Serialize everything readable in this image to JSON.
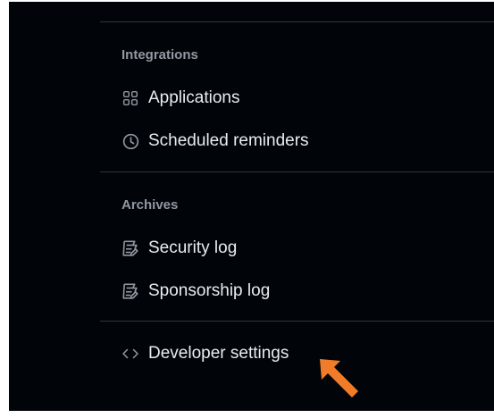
{
  "sidebar": {
    "integrations": {
      "title": "Integrations",
      "items": [
        {
          "label": "Applications",
          "icon": "apps-grid-icon"
        },
        {
          "label": "Scheduled reminders",
          "icon": "clock-icon"
        }
      ]
    },
    "archives": {
      "title": "Archives",
      "items": [
        {
          "label": "Security log",
          "icon": "log-icon"
        },
        {
          "label": "Sponsorship log",
          "icon": "log-icon"
        }
      ]
    },
    "developer": {
      "label": "Developer settings",
      "icon": "code-icon"
    }
  },
  "annotation": {
    "arrow_color": "#f07c2a",
    "arrow_icon": "arrow-pointer-icon"
  },
  "theme": {
    "background": "#010409",
    "text": "#e6edf3",
    "muted": "#9198a1",
    "divider": "#30363d"
  }
}
